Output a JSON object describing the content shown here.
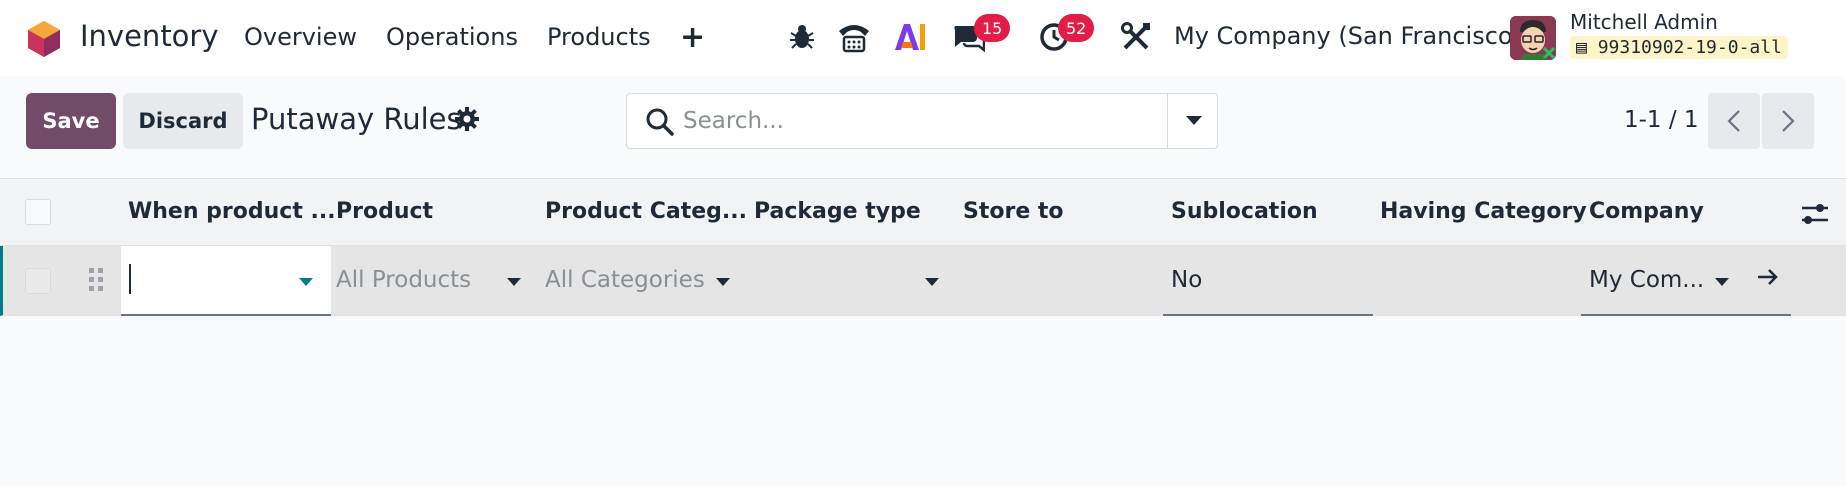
{
  "app": {
    "name": "Inventory",
    "brand_color": "#714b67",
    "accent_color": "#017e84"
  },
  "navbar": {
    "menu": [
      "Overview",
      "Operations",
      "Products"
    ],
    "icons": [
      "bug-icon",
      "phone-icon",
      "ai-icon",
      "chat-icon",
      "clock-icon",
      "tools-icon"
    ],
    "chat_count": "15",
    "activity_count": "52",
    "company": "My Company (San Francisco)",
    "user_name": "Mitchell Admin",
    "database": "99310902-19-0-all"
  },
  "control_panel": {
    "save_label": "Save",
    "discard_label": "Discard",
    "title": "Putaway Rules",
    "search_placeholder": "Search...",
    "pager": "1-1 / 1"
  },
  "table": {
    "columns": [
      "When product ...",
      "Product",
      "Product Categ...",
      "Package type",
      "Store to",
      "Sublocation",
      "Having Category",
      "Company"
    ],
    "row": {
      "when_product": "",
      "product": "All Products",
      "product_category": "All Categories",
      "package_type": "",
      "store_to": "",
      "sublocation": "No",
      "having_category": "",
      "company": "My Com..."
    }
  }
}
